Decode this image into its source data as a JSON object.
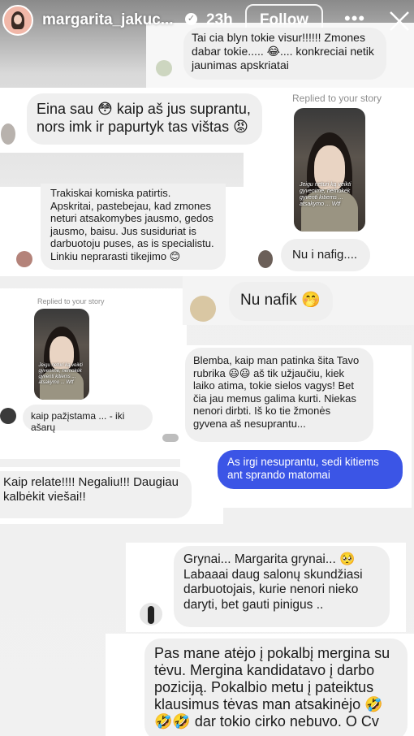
{
  "header": {
    "username": "margarita_jakuc...",
    "time": "23h",
    "follow_label": "Follow",
    "more_icon": "more-icon",
    "close_icon": "close-icon",
    "verified_icon": "verified-badge-icon"
  },
  "replied_label": "Replied to your story",
  "thumb_caption": "Jeigu neturi ką veikti gyvenime, nemokėk gyventi kitiems ... atsakymo ... Wtf",
  "messages": {
    "m1": "Tai cia blyn tokie visur!!!!!! Zmones dabar tokie..... 😂.... konkreciai netik jaunimas apskriatai",
    "m2": "Eina sau 😳 kaip aš jus suprantu, nors imk ir papurtyk tas vištas 😡",
    "m3": "Trakiskai komiska patirtis. Apskritai, pastebejau, kad zmones neturi atsakomybes jausmo, gedos jausmo, baisu. Jus susiduriat is darbuotoju puses, as is specialistu. Linkiu neprarasti tikejimo 😊",
    "m4": "Nu i nafig....",
    "m5": "Nu nafik 🤭",
    "m6": "kaip pažįstama ... - iki ašarų",
    "m7": "Blemba,  kaip man patinka šita Tavo rubrika 😃😃 aš tik užjaučiu, kiek laiko atima, tokie sielos vagys! Bet čia jau memus galima kurti. Niekas nenori dirbti. Iš ko tie žmonės gyvena aš nesuprantu...",
    "m8": "As irgi nesuprantu, sedi kitiems ant sprando matomai",
    "m9": "Kaip relate!!!! Negaliu!!! Daugiau kalbėkit viešai!!",
    "m10": "Grynai... Margarita grynai... 🥺 Labaaai daug salonų skundžiasi darbuotojais, kurie nenori nieko daryti, bet gauti pinigus ..",
    "m11": "Pas mane atėjo į pokalbį mergina su tėvu. Mergina kandidatavo į darbo poziciją. Pokalbio metu į pateiktus klausimus tėvas man atsakinėjo 🤣 🤣🤣 dar tokio cirko nebuvo. O Cv"
  },
  "colors": {
    "blue": "#3b55e6",
    "gray": "#efefef"
  }
}
